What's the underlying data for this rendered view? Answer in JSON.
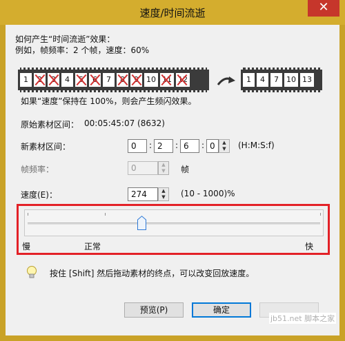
{
  "window": {
    "title": "速度/时间流逝",
    "close_glyph": "✕"
  },
  "intro": {
    "line1": "如何产生“时间流逝”效果：",
    "line2": "例如，帧频率：2 个帧，速度：60%"
  },
  "film_before": {
    "frames": [
      {
        "label": "1",
        "crossed": false
      },
      {
        "label": "2",
        "crossed": true
      },
      {
        "label": "3",
        "crossed": true
      },
      {
        "label": "4",
        "crossed": false
      },
      {
        "label": "5",
        "crossed": true
      },
      {
        "label": "6",
        "crossed": true
      },
      {
        "label": "7",
        "crossed": false
      },
      {
        "label": "8",
        "crossed": true
      },
      {
        "label": "9",
        "crossed": true
      },
      {
        "label": "10",
        "crossed": false
      },
      {
        "label": "11",
        "crossed": true
      },
      {
        "label": "12",
        "crossed": true
      }
    ]
  },
  "film_after": {
    "frames": [
      "1",
      "4",
      "7",
      "10",
      "13"
    ]
  },
  "note": "如果“速度”保持在 100%，则会产生频闪效果。",
  "original_range": {
    "label": "原始素材区间：",
    "value": "00:05:45:07 (8632)"
  },
  "new_range": {
    "label": "新素材区间：",
    "h": "0",
    "m": "2",
    "s": "6",
    "f": "0",
    "sep": ":",
    "format": "(H:M:S:f)"
  },
  "frame_rate": {
    "label": "帧频率：",
    "value": "0",
    "unit": "帧"
  },
  "speed": {
    "label": "速度(E)：",
    "value": "274",
    "range": "(10 - 1000)%"
  },
  "slider": {
    "label_slow": "慢",
    "label_normal": "正常",
    "label_fast": "快",
    "position_fraction": 0.39
  },
  "hint": "按住 [Shift] 然后拖动素材的终点，可以改变回放速度。",
  "buttons": {
    "preview": "预览(P)",
    "ok": "确定"
  },
  "watermark": "jb51.net 脚本之家",
  "colors": {
    "highlight_frame": "#e32127",
    "title_bar": "#d4ad2e",
    "close_button": "#c6362b",
    "cross_mark": "#d23131"
  }
}
